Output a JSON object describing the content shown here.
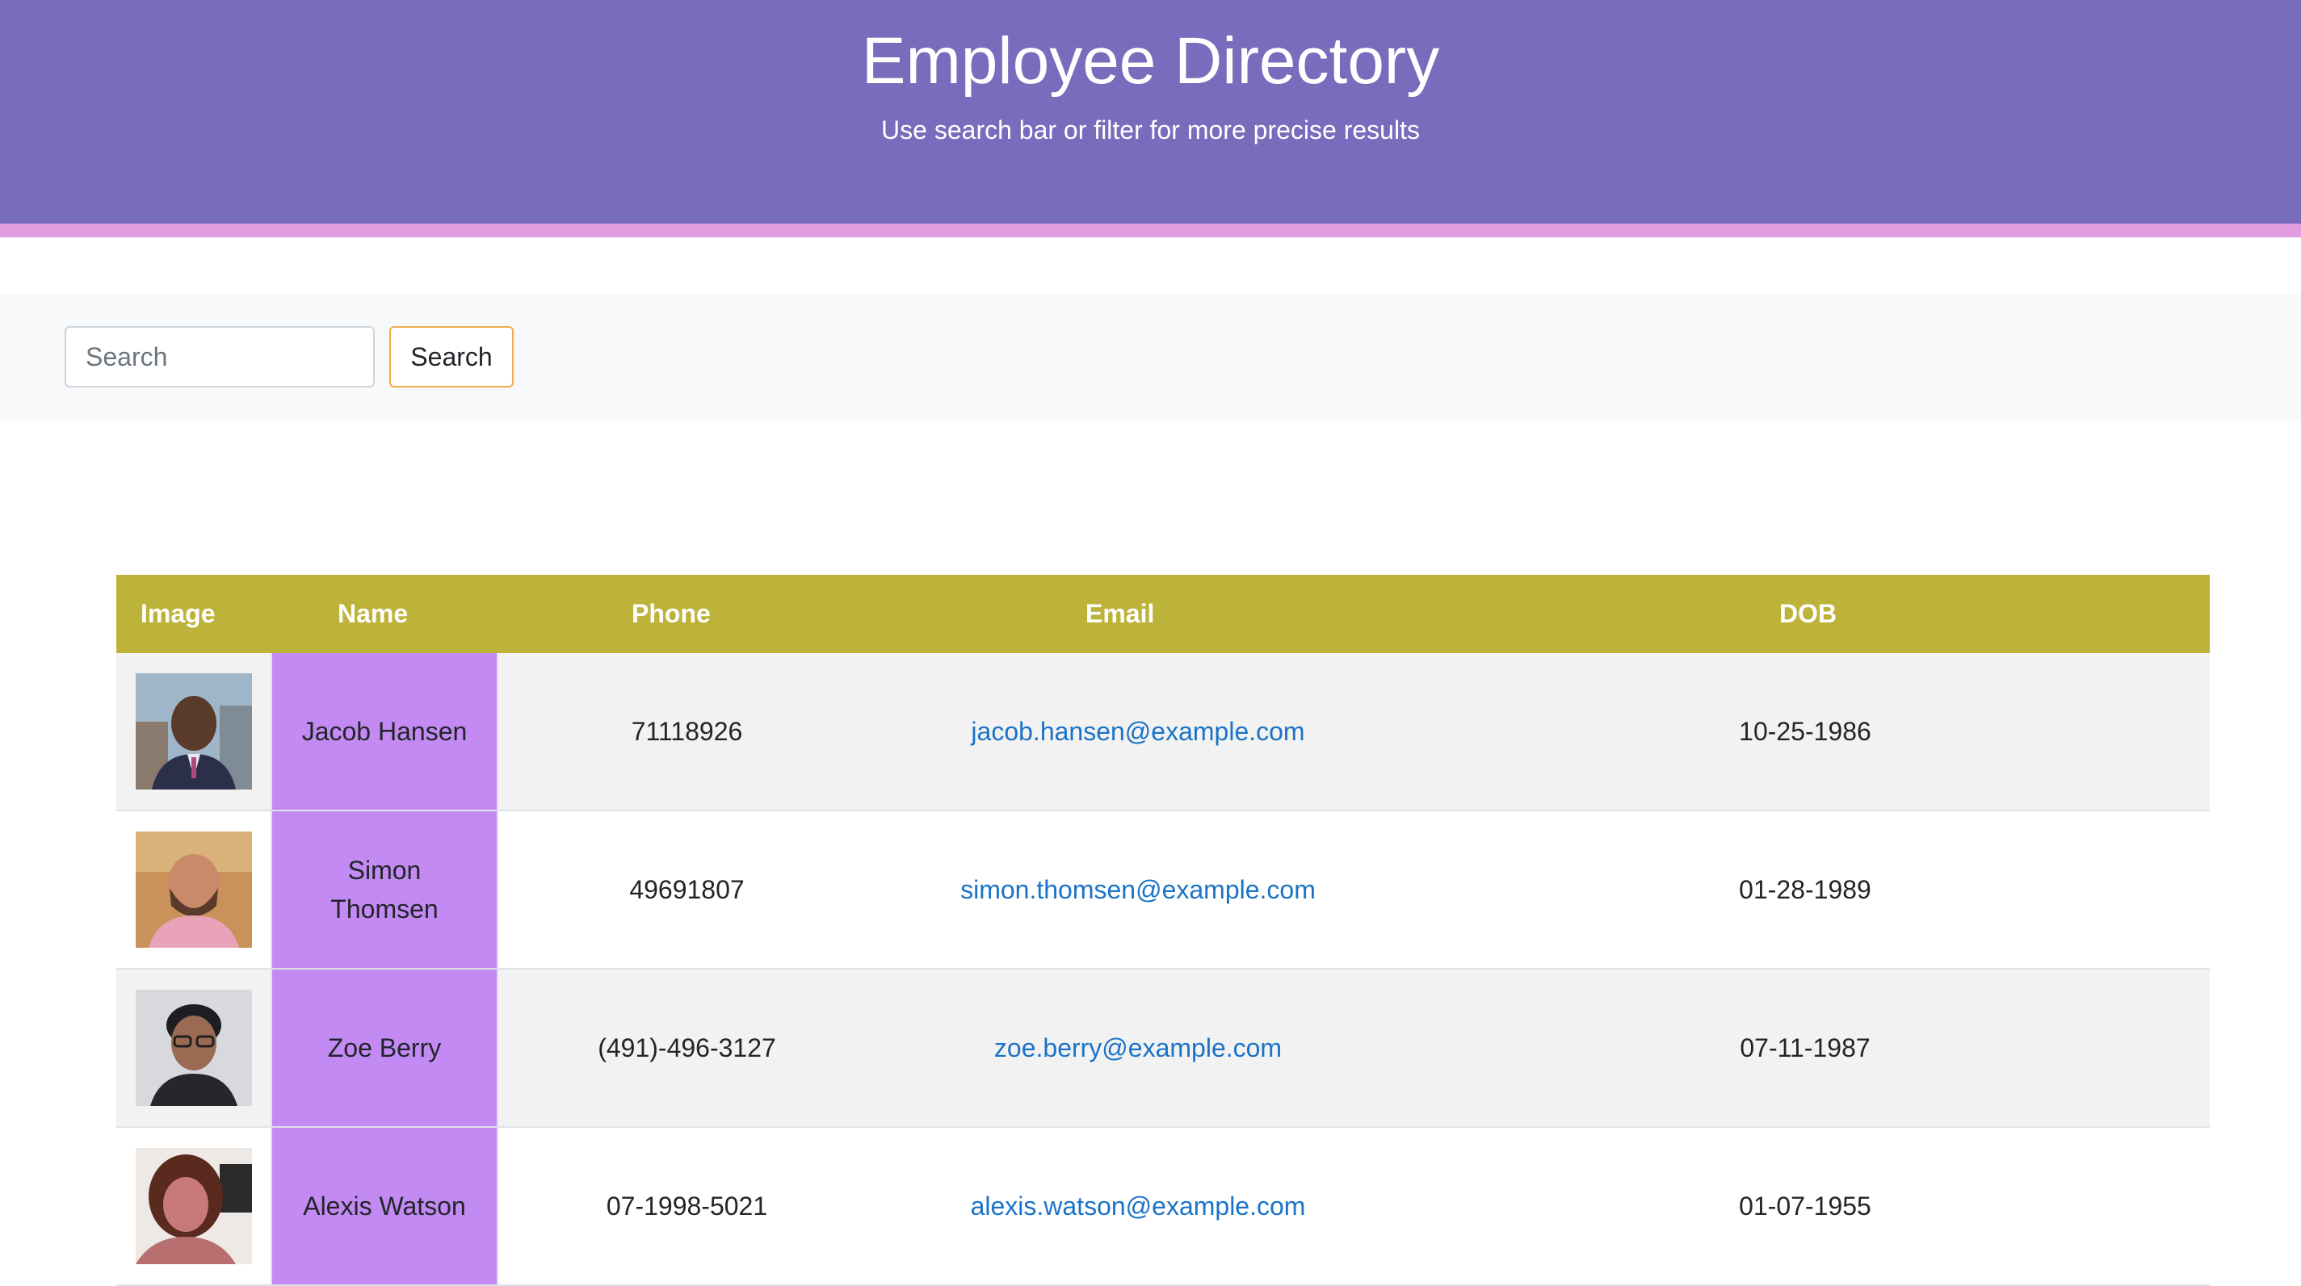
{
  "header": {
    "title": "Employee Directory",
    "subtitle": "Use search bar or filter for more precise results"
  },
  "search": {
    "placeholder": "Search",
    "value": "",
    "button_label": "Search"
  },
  "colors": {
    "header_bg": "#786cbc",
    "accent_bar": "#e29ce0",
    "table_header_bg": "#bdb33a",
    "name_cell_bg": "#c48af3",
    "link": "#1a73c8",
    "search_button_border": "#f0ad4e"
  },
  "table": {
    "columns": [
      "Image",
      "Name",
      "Phone",
      "Email",
      "DOB"
    ],
    "rows": [
      {
        "name": "Jacob Hansen",
        "phone": "71118926",
        "email": "jacob.hansen@example.com",
        "dob": "10-25-1986"
      },
      {
        "name": "Simon Thomsen",
        "phone": "49691807",
        "email": "simon.thomsen@example.com",
        "dob": "01-28-1989"
      },
      {
        "name": "Zoe Berry",
        "phone": "(491)-496-3127",
        "email": "zoe.berry@example.com",
        "dob": "07-11-1987"
      },
      {
        "name": "Alexis Watson",
        "phone": "07-1998-5021",
        "email": "alexis.watson@example.com",
        "dob": "01-07-1955"
      }
    ]
  }
}
